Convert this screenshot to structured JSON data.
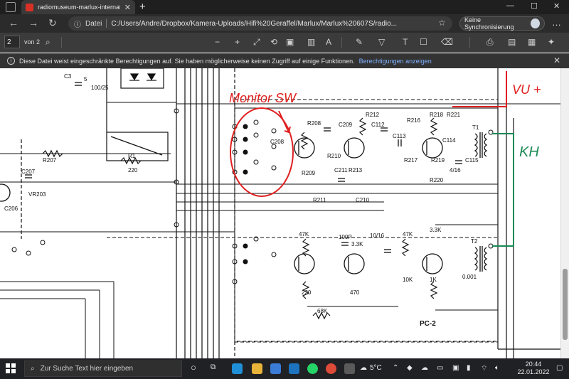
{
  "browser": {
    "tab_title": "radiomuseum-marlux-internation",
    "window_controls": {
      "minimize": "—",
      "maximize": "☐",
      "close": "✕"
    },
    "new_tab": "+"
  },
  "address_bar": {
    "label": "Datei",
    "url": "C:/Users/Andre/Dropbox/Kamera-Uploads/Hifi%20Geraffel/Marlux/Marlux%20607S/radio...",
    "sync_label": "Keine Synchronisierung"
  },
  "pdf_toolbar": {
    "page_current": "2",
    "page_total_label": "von 2"
  },
  "infobar": {
    "message": "Diese Datei weist eingeschränkte Berechtigungen auf. Sie haben möglicherweise keinen Zugriff auf einige Funktionen.",
    "link": "Berechtigungen anzeigen"
  },
  "schematic": {
    "annotations": {
      "monitor_sw": "Monitor SW",
      "vu": "VU +",
      "kh": "KH"
    },
    "labels": {
      "c3": "C3",
      "c5": "5",
      "c100": "100/25",
      "c207": "C207",
      "r207": "R207",
      "r1": "R1",
      "r220": "220",
      "c206": "C206",
      "vr": "VR203",
      "c208": "C208",
      "r208": "R208",
      "c209": "C209",
      "r212": "R212",
      "c112": "C112",
      "c113": "C113",
      "r216": "R216",
      "r218": "R218",
      "r221": "R221",
      "t1": "T1",
      "r210": "R210",
      "r209": "R209",
      "c211": "C211",
      "r213": "R213",
      "r211": "R211",
      "c210": "C210",
      "c114": "C114",
      "r217": "R217",
      "r219": "R219",
      "r220b": "R220",
      "c115": "C115",
      "v47": "4/16",
      "r47k": "47K",
      "c100p": "100P",
      "c33k": "3.3K",
      "c1016": "10/16",
      "r47k2": "47K",
      "c33k2": "3.3K",
      "t2": "T2",
      "r220c": "220",
      "r470": "470",
      "r10k": "10K",
      "r1k": "1K",
      "c001": "0.001",
      "r68k": "68K",
      "pc2": "PC-2"
    }
  },
  "taskbar": {
    "search_placeholder": "Zur Suche Text hier eingeben",
    "weather": "5°C",
    "time": "20:44",
    "date": "22.01.2022"
  },
  "colors": {
    "annotation_red": "#e02020",
    "annotation_green": "#1a8a55",
    "link_blue": "#7fb0ff"
  }
}
